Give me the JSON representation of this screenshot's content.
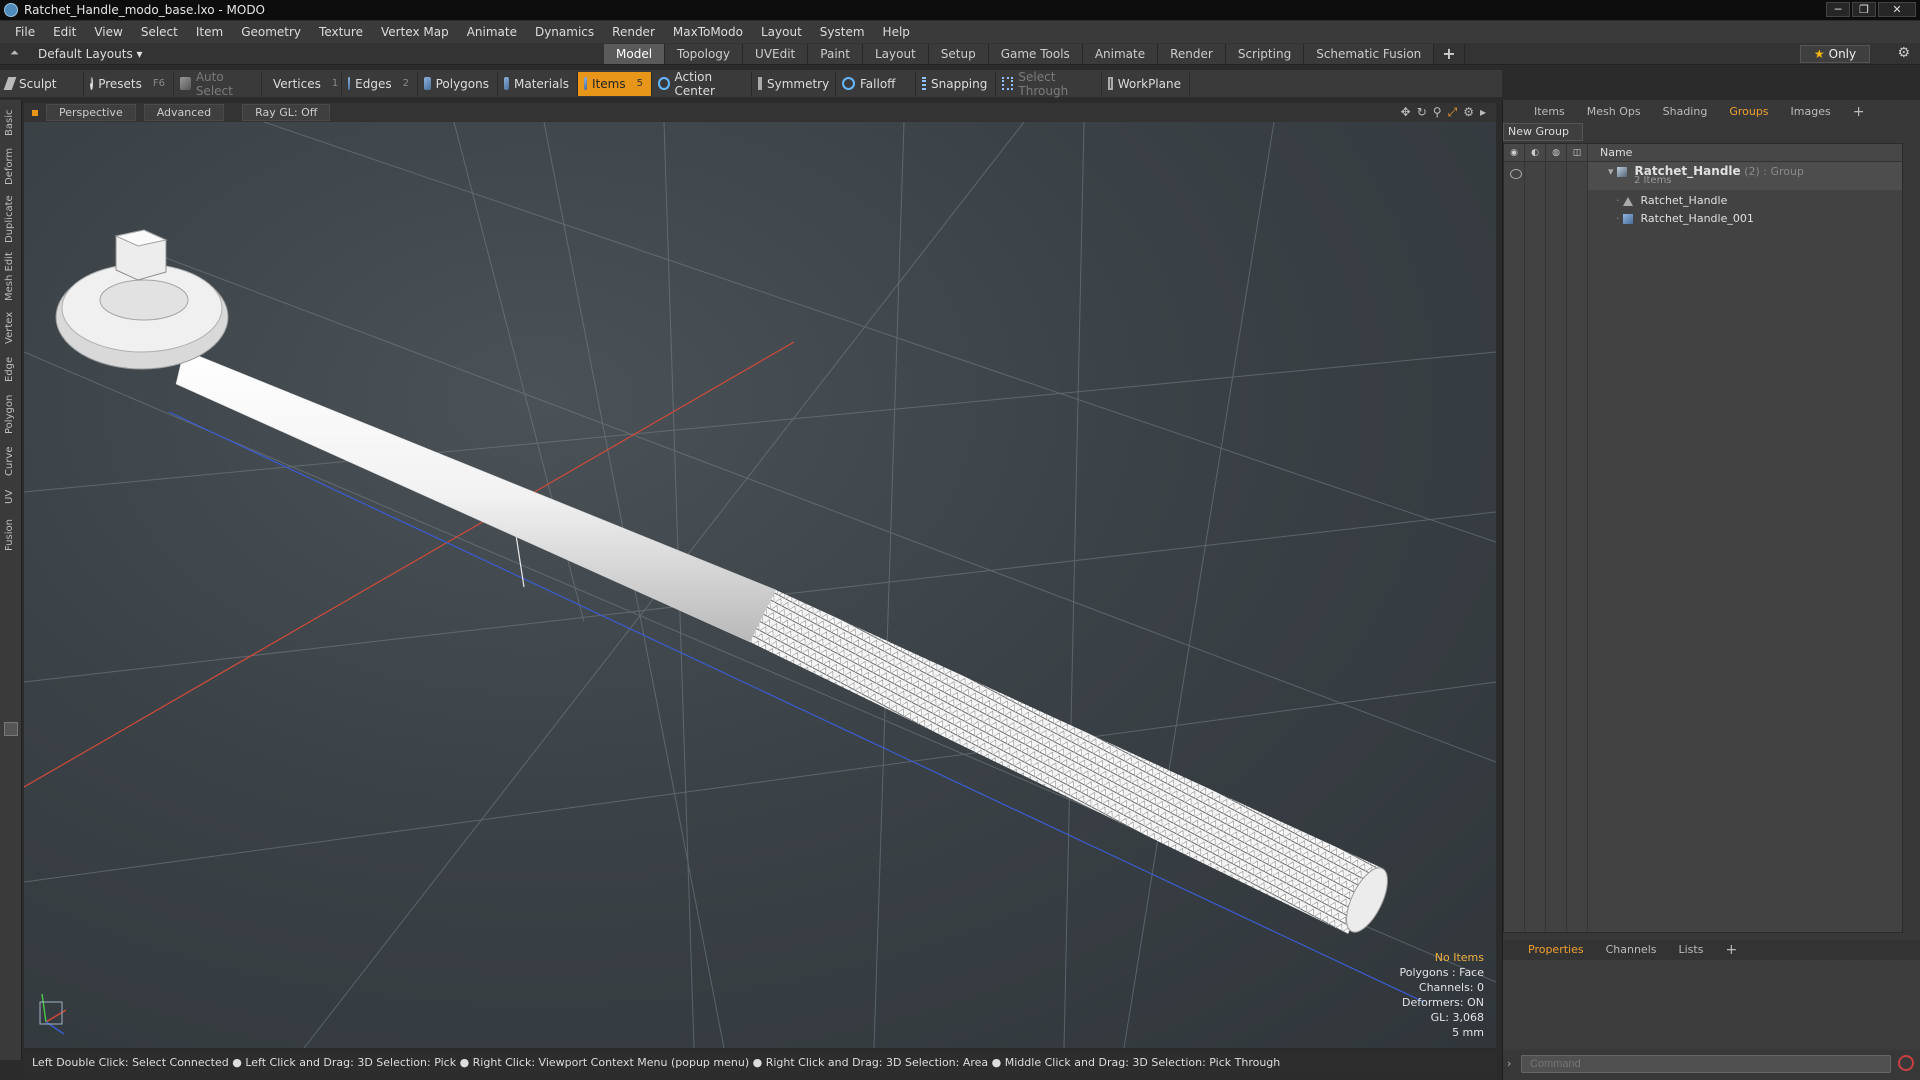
{
  "window": {
    "title": "Ratchet_Handle_modo_base.lxo - MODO",
    "controls": [
      "─",
      "❐",
      "✕"
    ]
  },
  "menu": [
    "File",
    "Edit",
    "View",
    "Select",
    "Item",
    "Geometry",
    "Texture",
    "Vertex Map",
    "Animate",
    "Dynamics",
    "Render",
    "MaxToModo",
    "Layout",
    "System",
    "Help"
  ],
  "layout": {
    "dropdown": "Default Layouts ▾",
    "tabs": [
      "Model",
      "Topology",
      "UVEdit",
      "Paint",
      "Layout",
      "Setup",
      "Game Tools",
      "Animate",
      "Render",
      "Scripting",
      "Schematic Fusion"
    ],
    "active_tab": "Model",
    "add_tab": "+",
    "only_label": "Only"
  },
  "toolbar": {
    "sculpt": "Sculpt",
    "presets": "Presets",
    "presets_key": "F6",
    "auto_select": "Auto Select",
    "vertices": "Vertices",
    "vertices_key": "1",
    "edges": "Edges",
    "edges_key": "2",
    "polygons": "Polygons",
    "materials": "Materials",
    "items": "Items",
    "items_key": "5",
    "action_center": "Action Center",
    "symmetry": "Symmetry",
    "falloff": "Falloff",
    "snapping": "Snapping",
    "select_through": "Select Through",
    "workplane": "WorkPlane"
  },
  "left_tabs": [
    "Basic",
    "Deform",
    "Duplicate",
    "Mesh Edit",
    "Vertex",
    "Edge",
    "Polygon",
    "Curve",
    "UV",
    "Fusion"
  ],
  "viewport": {
    "view": "Perspective",
    "shading": "Advanced",
    "raygl": "Ray GL: Off",
    "info": {
      "items": "No Items",
      "polygons": "Polygons : Face",
      "channels": "Channels: 0",
      "deformers": "Deformers: ON",
      "gl": "GL: 3,068",
      "unit": "5 mm"
    }
  },
  "status": "Left Double Click: Select Connected ● Left Click and Drag: 3D Selection: Pick ● Right Click: Viewport Context Menu (popup menu) ● Right Click and Drag: 3D Selection: Area ● Middle Click and Drag: 3D Selection: Pick Through",
  "right_panel": {
    "tabs": [
      "Items",
      "Mesh Ops",
      "Shading",
      "Groups",
      "Images",
      "+"
    ],
    "active_tab": "Groups",
    "new_group": "New Group",
    "column_name": "Name",
    "group": {
      "name": "Ratchet_Handle",
      "count": "(2)",
      "type": ": Group",
      "sub": "2 Items"
    },
    "children": [
      "Ratchet_Handle",
      "Ratchet_Handle_001"
    ],
    "bottom_tabs": [
      "Properties",
      "Channels",
      "Lists",
      "+"
    ],
    "bottom_active": "Properties",
    "command_placeholder": "Command"
  },
  "colors": {
    "accent": "#e8961a",
    "active_tab_text": "#f0a030",
    "axis_red": "#d04a3a",
    "axis_blue": "#3a5cd0"
  }
}
